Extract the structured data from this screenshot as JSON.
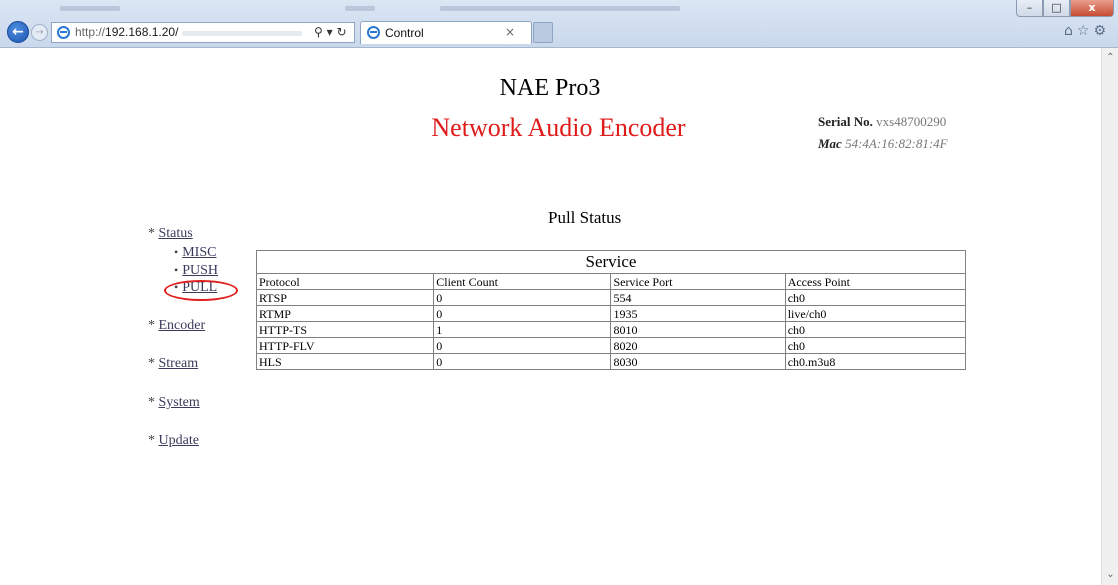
{
  "browser": {
    "url_prefix": "http://",
    "url_host": "192.168.1.20/",
    "tab_title": "Control",
    "tab_close": "×",
    "win_min": "–",
    "win_max": "□",
    "win_close": "x"
  },
  "header": {
    "title": "NAE Pro3",
    "subtitle": "Network Audio Encoder",
    "serial_label": "Serial No.",
    "serial_value": "vxs48700290",
    "mac_label": "Mac",
    "mac_value": "54:4A:16:82:81:4F"
  },
  "sidebar": {
    "status": "Status",
    "status_sub": [
      "MISC",
      "PUSH",
      "PULL"
    ],
    "encoder": "Encoder",
    "stream": "Stream",
    "system": "System",
    "update": "Update",
    "marker": "*",
    "bullet": "•"
  },
  "main": {
    "section_title": "Pull Status",
    "table_caption": "Service",
    "columns": [
      "Protocol",
      "Client Count",
      "Service Port",
      "Access Point"
    ],
    "rows": [
      [
        "RTSP",
        "0",
        "554",
        "ch0"
      ],
      [
        "RTMP",
        "0",
        "1935",
        "live/ch0"
      ],
      [
        "HTTP-TS",
        "1",
        "8010",
        "ch0"
      ],
      [
        "HTTP-FLV",
        "0",
        "8020",
        "ch0"
      ],
      [
        "HLS",
        "0",
        "8030",
        "ch0.m3u8"
      ]
    ]
  },
  "colors": {
    "subtitle": "#e01b1b",
    "highlight": "#e02020"
  }
}
